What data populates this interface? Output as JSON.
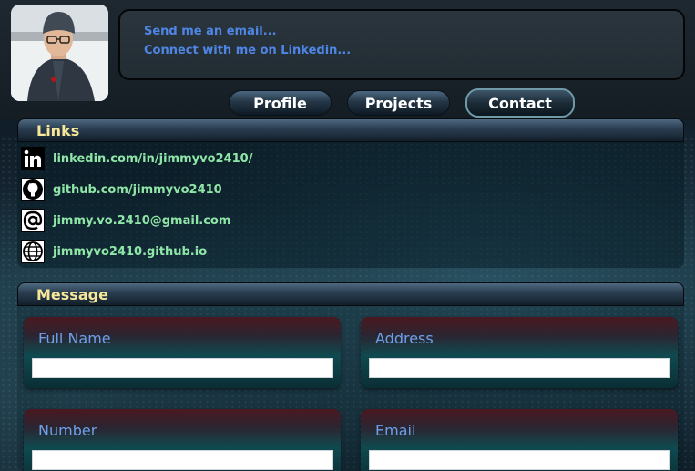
{
  "header": {
    "contact_links": [
      {
        "label": "Send me an email..."
      },
      {
        "label": "Connect with me on Linkedin..."
      }
    ]
  },
  "nav": {
    "tabs": [
      {
        "label": "Profile",
        "active": false
      },
      {
        "label": "Projects",
        "active": false
      },
      {
        "label": "Contact",
        "active": true
      }
    ]
  },
  "links_panel": {
    "title": "Links",
    "items": [
      {
        "icon": "linkedin-icon",
        "text": "linkedin.com/in/jimmyvo2410/"
      },
      {
        "icon": "github-icon",
        "text": "github.com/jimmyvo2410"
      },
      {
        "icon": "at-sign-icon",
        "text": "jimmy.vo.2410@gmail.com"
      },
      {
        "icon": "globe-icon",
        "text": "jimmyvo2410.github.io"
      }
    ]
  },
  "message_panel": {
    "title": "Message",
    "fields": [
      {
        "label": "Full Name",
        "value": ""
      },
      {
        "label": "Address",
        "value": ""
      },
      {
        "label": "Number",
        "value": ""
      },
      {
        "label": "Email",
        "value": ""
      }
    ]
  },
  "colors": {
    "link_blue": "#4f86e6",
    "link_green": "#8fe6a8",
    "panel_title": "#f6e79a",
    "field_label": "#6f9fe8"
  }
}
